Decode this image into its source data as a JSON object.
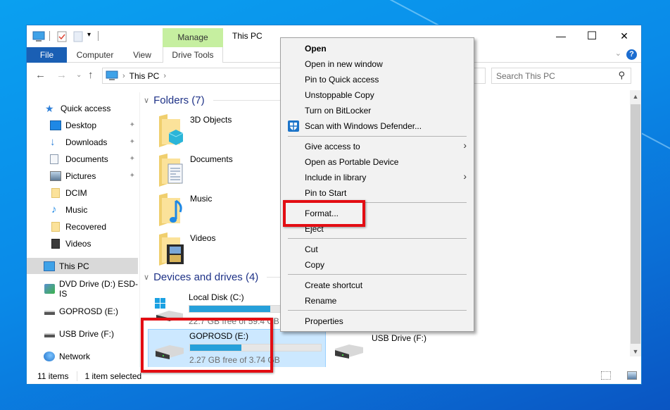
{
  "window": {
    "title": "This PC",
    "contextual_tab_group": "Manage",
    "controls": {
      "minimize": "—",
      "maximize": "☐",
      "close": "✕"
    }
  },
  "ribbon": {
    "tabs": [
      {
        "label": "File",
        "active": true
      },
      {
        "label": "Computer"
      },
      {
        "label": "View"
      },
      {
        "label": "Drive Tools"
      }
    ],
    "help_icon": "?",
    "collapse_icon": "⌄"
  },
  "nav": {
    "back": "←",
    "forward": "→",
    "recent": "⌄",
    "up": "↑",
    "breadcrumb": [
      "This PC"
    ],
    "refresh_icon": "↻",
    "search_placeholder": "Search This PC",
    "search_icon": "⚲"
  },
  "sidebar": {
    "items": [
      {
        "label": "Quick access",
        "icon": "star-icon",
        "pinned": false
      },
      {
        "label": "Desktop",
        "icon": "desktop-icon",
        "pinned": true
      },
      {
        "label": "Downloads",
        "icon": "downloads-icon",
        "pinned": true
      },
      {
        "label": "Documents",
        "icon": "documents-icon",
        "pinned": true
      },
      {
        "label": "Pictures",
        "icon": "pictures-icon",
        "pinned": true
      },
      {
        "label": "DCIM",
        "icon": "folder-icon",
        "pinned": false
      },
      {
        "label": "Music",
        "icon": "music-icon",
        "pinned": false
      },
      {
        "label": "Recovered",
        "icon": "folder-icon",
        "pinned": false
      },
      {
        "label": "Videos",
        "icon": "videos-icon",
        "pinned": false
      },
      {
        "label": "This PC",
        "icon": "computer-icon",
        "selected": true
      },
      {
        "label": "DVD Drive (D:) ESD-IS",
        "icon": "dvd-drive-icon"
      },
      {
        "label": "GOPROSD (E:)",
        "icon": "drive-icon"
      },
      {
        "label": "USB Drive (F:)",
        "icon": "drive-icon"
      },
      {
        "label": "Network",
        "icon": "network-icon"
      }
    ],
    "pin_glyph": "📌"
  },
  "content": {
    "folders_header": "Folders (7)",
    "folders": [
      {
        "label": "3D Objects"
      },
      {
        "label": "Documents"
      },
      {
        "label": "Music"
      },
      {
        "label": "Videos"
      }
    ],
    "drives_header": "Devices and drives (4)",
    "drives": [
      {
        "label": "Local Disk (C:)",
        "free": "22.7 GB free of 59.4 GB",
        "used_fraction": 0.62
      },
      {
        "label": "GOPROSD (E:)",
        "free": "2.27 GB free of 3.74 GB",
        "used_fraction": 0.39,
        "selected": true
      },
      {
        "label": "USB Drive (F:)"
      }
    ]
  },
  "status": {
    "items": "11 items",
    "selected": "1 item selected"
  },
  "context_menu": {
    "groups": [
      [
        {
          "label": "Open",
          "bold": true
        },
        {
          "label": "Open in new window"
        },
        {
          "label": "Pin to Quick access"
        },
        {
          "label": "Unstoppable Copy"
        },
        {
          "label": "Turn on BitLocker"
        },
        {
          "label": "Scan with Windows Defender...",
          "icon": "windows-defender-icon"
        }
      ],
      [
        {
          "label": "Give access to",
          "submenu": true
        },
        {
          "label": "Open as Portable Device"
        },
        {
          "label": "Include in library",
          "submenu": true
        },
        {
          "label": "Pin to Start"
        }
      ],
      [
        {
          "label": "Format...",
          "highlighted": true
        },
        {
          "label": "Eject"
        }
      ],
      [
        {
          "label": "Cut"
        },
        {
          "label": "Copy"
        }
      ],
      [
        {
          "label": "Create shortcut"
        },
        {
          "label": "Rename"
        }
      ],
      [
        {
          "label": "Properties"
        }
      ]
    ],
    "submenu_arrow": "›"
  },
  "colors": {
    "accent": "#1a5fb4",
    "manage_tab": "#c6efa0",
    "selection": "#cce8ff",
    "progress": "#26a0da",
    "highlight_box": "#e30d13",
    "group_header": "#1e3287"
  }
}
